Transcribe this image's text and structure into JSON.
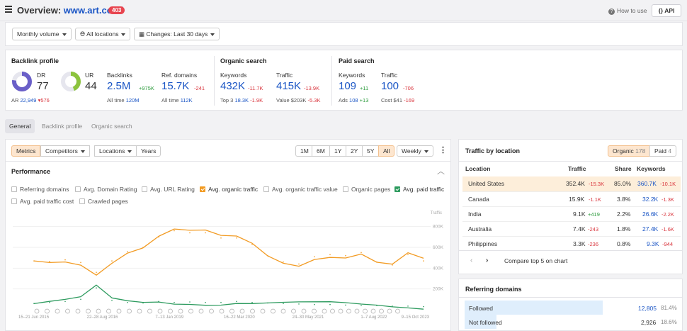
{
  "header": {
    "title_prefix": "Overview:",
    "url": "www.art.com/",
    "badge": "403",
    "how_to_use": "How to use",
    "api_label": "API",
    "api_icon": "braces-icon"
  },
  "filters": {
    "mode": "Monthly volume",
    "locations": "All locations",
    "changes": "Changes: Last 30 days"
  },
  "metrics": {
    "backlink_profile": {
      "title": "Backlink profile",
      "dr_label": "DR",
      "dr_value": "77",
      "dr_fraction": 0.77,
      "ur_label": "UR",
      "ur_value": "44",
      "ur_fraction": 0.44,
      "ar_label": "AR",
      "ar_value": "22,949",
      "ar_change": "▾576",
      "backlinks_label": "Backlinks",
      "backlinks_value": "2.5M",
      "backlinks_change": "+975K",
      "backlinks_alltime_label": "All time",
      "backlinks_alltime": "120M",
      "refdomains_label": "Ref. domains",
      "refdomains_value": "15.7K",
      "refdomains_change": "-241",
      "refdomains_alltime_label": "All time",
      "refdomains_alltime": "112K"
    },
    "organic": {
      "title": "Organic search",
      "keywords_label": "Keywords",
      "keywords_value": "432K",
      "keywords_change": "-11.7K",
      "top3_label": "Top 3",
      "top3_value": "18.3K",
      "top3_change": "-1.9K",
      "traffic_label": "Traffic",
      "traffic_value": "415K",
      "traffic_change": "-13.9K",
      "value_label": "Value",
      "value_value": "$203K",
      "value_change": "-5.3K"
    },
    "paid": {
      "title": "Paid search",
      "keywords_label": "Keywords",
      "keywords_value": "109",
      "keywords_change": "+11",
      "ads_label": "Ads",
      "ads_value": "108",
      "ads_change": "+13",
      "traffic_label": "Traffic",
      "traffic_value": "100",
      "traffic_change": "-706",
      "cost_label": "Cost",
      "cost_value": "$41",
      "cost_change": "-169"
    }
  },
  "tabs": [
    "General",
    "Backlink profile",
    "Organic search"
  ],
  "chart_toolbar": {
    "left": [
      "Metrics",
      "Competitors",
      "Locations",
      "Years"
    ],
    "ranges": [
      "1M",
      "6M",
      "1Y",
      "2Y",
      "5Y",
      "All"
    ],
    "granularity": "Weekly",
    "more_icon": "vertical-dots-icon"
  },
  "performance": {
    "title": "Performance",
    "collapse_icon": "chevron-up-icon",
    "checkboxes": [
      {
        "label": "Referring domains",
        "checked": false
      },
      {
        "label": "Avg. Domain Rating",
        "checked": false
      },
      {
        "label": "Avg. URL Rating",
        "checked": false
      },
      {
        "label": "Avg. organic traffic",
        "checked": true,
        "color": "#f29b23"
      },
      {
        "label": "Avg. organic traffic value",
        "checked": false
      },
      {
        "label": "Organic pages",
        "checked": false
      },
      {
        "label": "Avg. paid traffic",
        "checked": true,
        "color": "#2e9b5f"
      },
      {
        "label": "Avg. paid traffic cost",
        "checked": false
      },
      {
        "label": "Crawled pages",
        "checked": false
      }
    ]
  },
  "chart_data": {
    "type": "line",
    "y_axis_title": "Traffic",
    "y_ticks": [
      "800K",
      "600K",
      "400K",
      "200K"
    ],
    "ylim": [
      0,
      900000
    ],
    "x_ticks": [
      "15–21 Jun 2015",
      "22–28 Aug 2016",
      "7–13 Jan 2019",
      "16–22 Mar 2020",
      "24–30 May 2021",
      "1–7 Aug 2022",
      "9–15 Oct 2023"
    ],
    "x": [
      "2015-06",
      "2015-10",
      "2016-02",
      "2016-06",
      "2016-10",
      "2017-02",
      "2017-06",
      "2017-10",
      "2018-02",
      "2018-06",
      "2018-10",
      "2019-02",
      "2019-06",
      "2019-10",
      "2020-02",
      "2020-06",
      "2020-10",
      "2021-02",
      "2021-06",
      "2021-10",
      "2022-02",
      "2022-06",
      "2022-10",
      "2023-02",
      "2023-06",
      "2023-10"
    ],
    "series": [
      {
        "color": "#f29b23",
        "values": [
          470000,
          465000,
          480000,
          455000,
          360000,
          470000,
          560000,
          600000,
          700000,
          760000,
          740000,
          740000,
          690000,
          690000,
          630000,
          520000,
          460000,
          440000,
          510000,
          530000,
          520000,
          550000,
          460000,
          430000,
          530000,
          470000
        ]
      },
      {
        "color": "#2e9b5f",
        "values": [
          60000,
          70000,
          80000,
          100000,
          210000,
          90000,
          70000,
          65000,
          80000,
          70000,
          75000,
          70000,
          70000,
          80000,
          70000,
          65000,
          60000,
          55000,
          50000,
          50000,
          45000,
          40000,
          40000,
          35000,
          35000,
          30000
        ]
      }
    ],
    "grid": true
  },
  "traffic_by_location": {
    "title": "Traffic by location",
    "toggle_organic": "Organic",
    "toggle_organic_count": "178",
    "toggle_paid": "Paid",
    "toggle_paid_count": "4",
    "headers": [
      "Location",
      "Traffic",
      "Share",
      "Keywords"
    ],
    "rows": [
      {
        "location": "United States",
        "traffic": "352.4K",
        "traffic_change": "-15.3K",
        "share": "85.0%",
        "keywords": "360.7K",
        "keywords_change": "-10.1K"
      },
      {
        "location": "Canada",
        "traffic": "15.9K",
        "traffic_change": "-1.1K",
        "share": "3.8%",
        "keywords": "32.2K",
        "keywords_change": "-1.3K"
      },
      {
        "location": "India",
        "traffic": "9.1K",
        "traffic_change": "+419",
        "share": "2.2%",
        "keywords": "26.6K",
        "keywords_change": "-2.2K"
      },
      {
        "location": "Australia",
        "traffic": "7.4K",
        "traffic_change": "-243",
        "share": "1.8%",
        "keywords": "27.4K",
        "keywords_change": "-1.6K"
      },
      {
        "location": "Philippines",
        "traffic": "3.3K",
        "traffic_change": "-236",
        "share": "0.8%",
        "keywords": "9.3K",
        "keywords_change": "-944"
      }
    ],
    "compare_label": "Compare top 5 on chart"
  },
  "referring_domains": {
    "title": "Referring domains",
    "rows": [
      {
        "label": "Followed",
        "value": "12,805",
        "pct": "81.4%",
        "fraction": 0.814
      },
      {
        "label": "Not followed",
        "value": "2,926",
        "pct": "18.6%",
        "fraction": 0.186
      }
    ]
  }
}
